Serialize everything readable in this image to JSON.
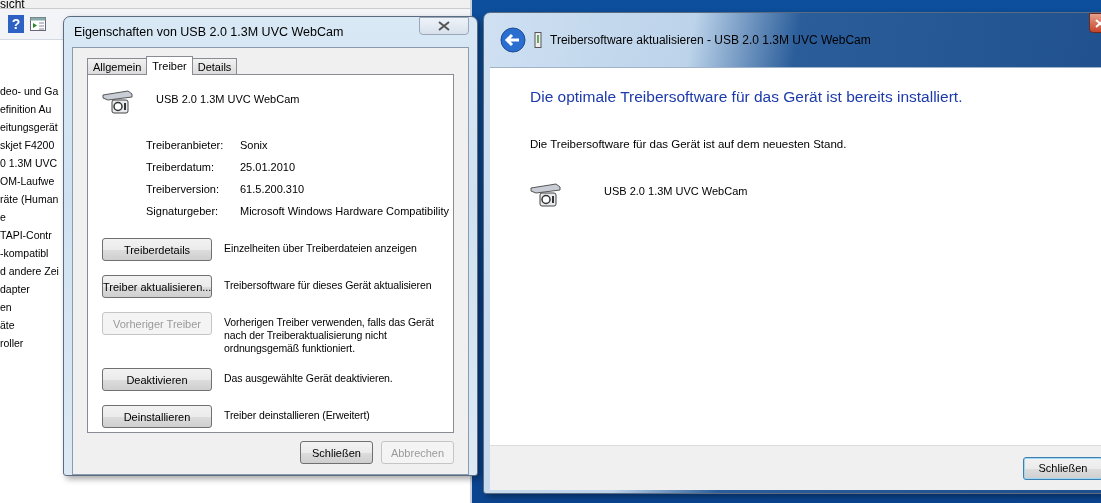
{
  "background_window": {
    "menu_text": "sicht",
    "help_glyph": "?",
    "tree_items": [
      "deo- und Ga",
      "efinition Au",
      "eitungsgerät",
      "skjet F4200",
      "0 1.3M UVC",
      "OM-Laufwe",
      "räte (Human",
      "e",
      "TAPI-Contr",
      "-kompatibl",
      "d andere Zei",
      "dapter",
      "en",
      "äte",
      "roller"
    ]
  },
  "properties_dialog": {
    "title": "Eigenschaften von USB 2.0 1.3M UVC WebCam",
    "tabs": [
      {
        "label": "Allgemein",
        "selected": false
      },
      {
        "label": "Treiber",
        "selected": true
      },
      {
        "label": "Details",
        "selected": false
      }
    ],
    "device_name": "USB 2.0 1.3M UVC WebCam",
    "fields": [
      {
        "label": "Treiberanbieter:",
        "value": "Sonix"
      },
      {
        "label": "Treiberdatum:",
        "value": "25.01.2010"
      },
      {
        "label": "Treiberversion:",
        "value": "61.5.200.310"
      },
      {
        "label": "Signaturgeber:",
        "value": "Microsoft Windows Hardware Compatibility"
      }
    ],
    "actions": [
      {
        "button": "Treiberdetails",
        "description": "Einzelheiten über Treiberdateien anzeigen",
        "disabled": false
      },
      {
        "button": "Treiber aktualisieren...",
        "description": "Treibersoftware für dieses Gerät aktualisieren",
        "disabled": false
      },
      {
        "button": "Vorheriger Treiber",
        "description": "Vorherigen Treiber verwenden, falls das Gerät nach der Treiberaktualisierung nicht ordnungsgemäß funktioniert.",
        "disabled": true
      },
      {
        "button": "Deaktivieren",
        "description": "Das ausgewählte Gerät deaktivieren.",
        "disabled": false
      },
      {
        "button": "Deinstallieren",
        "description": "Treiber deinstallieren (Erweitert)",
        "disabled": false
      }
    ],
    "buttons": [
      {
        "label": "Schließen",
        "disabled": false
      },
      {
        "label": "Abbrechen",
        "disabled": true
      }
    ]
  },
  "update_dialog": {
    "title": "Treibersoftware aktualisieren - USB 2.0 1.3M UVC WebCam",
    "heading": "Die optimale Treibersoftware für das Gerät ist bereits installiert.",
    "message": "Die Treibersoftware für das Gerät ist auf dem neuesten Stand.",
    "device_name": "USB 2.0 1.3M UVC WebCam",
    "buttons": [
      {
        "label": "Schließen",
        "disabled": false
      }
    ]
  }
}
